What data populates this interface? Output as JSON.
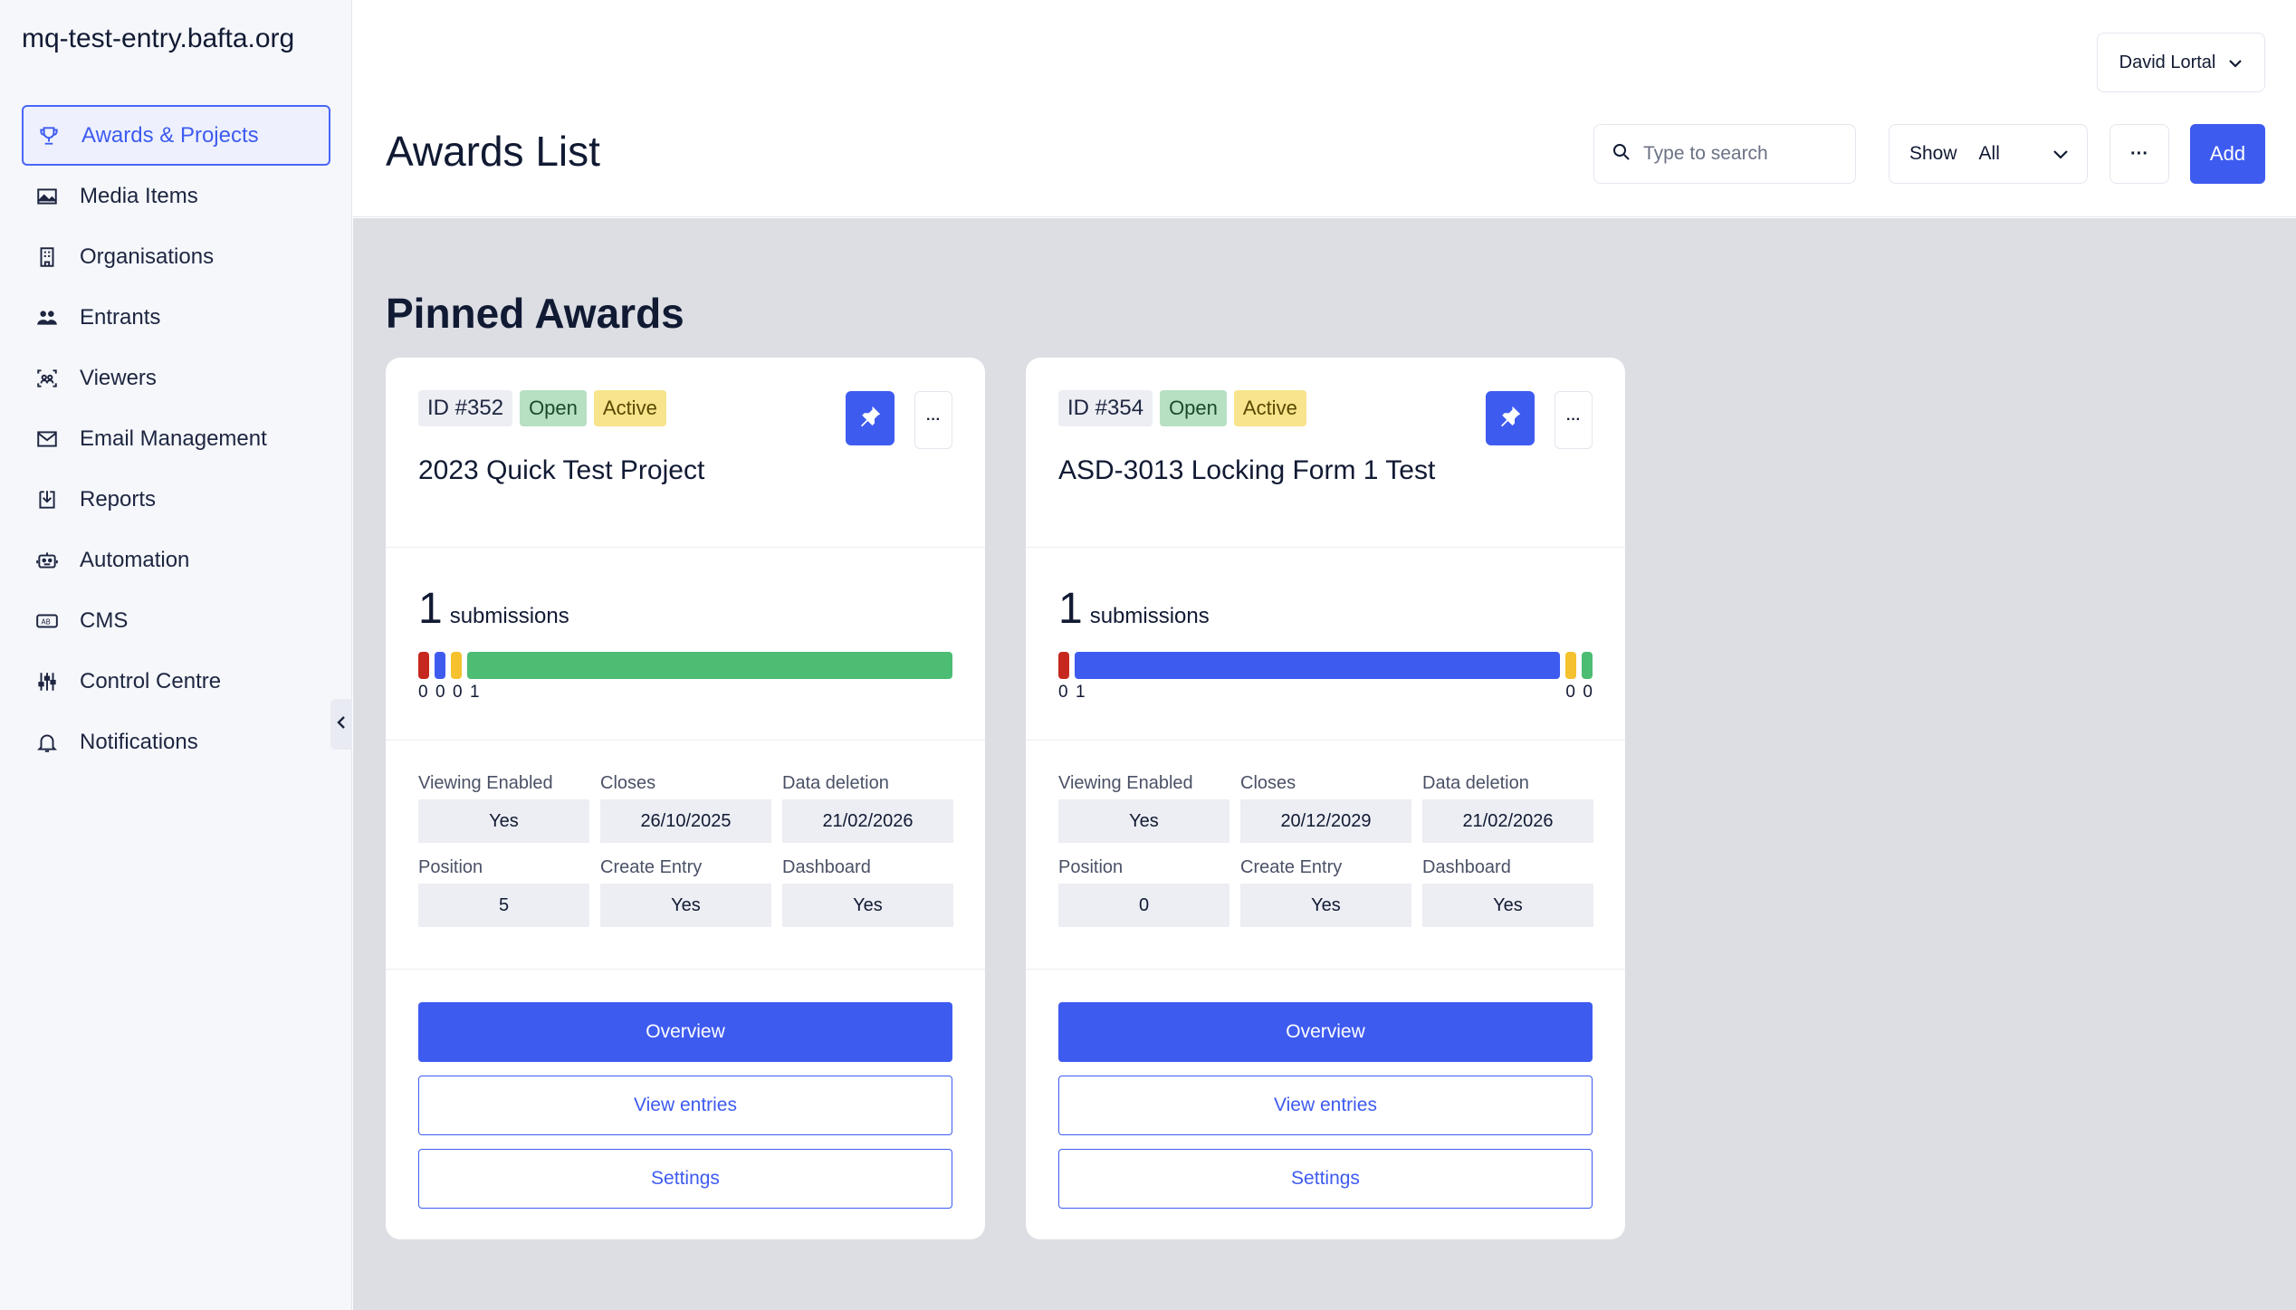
{
  "site": {
    "title": "mq-test-entry.bafta.org"
  },
  "sidebar": {
    "items": [
      {
        "label": "Awards & Projects",
        "icon": "trophy-icon",
        "active": true
      },
      {
        "label": "Media Items",
        "icon": "image-icon"
      },
      {
        "label": "Organisations",
        "icon": "building-icon"
      },
      {
        "label": "Entrants",
        "icon": "users-icon"
      },
      {
        "label": "Viewers",
        "icon": "viewers-icon"
      },
      {
        "label": "Email Management",
        "icon": "mail-icon"
      },
      {
        "label": "Reports",
        "icon": "download-icon"
      },
      {
        "label": "Automation",
        "icon": "robot-icon"
      },
      {
        "label": "CMS",
        "icon": "cms-icon"
      },
      {
        "label": "Control Centre",
        "icon": "sliders-icon"
      },
      {
        "label": "Notifications",
        "icon": "bell-icon"
      }
    ]
  },
  "header": {
    "user": "David Lortal",
    "title": "Awards List",
    "search_placeholder": "Type to search",
    "show_label": "Show",
    "show_value": "All",
    "more_label": "···",
    "add_label": "Add"
  },
  "main": {
    "section_title": "Pinned Awards",
    "cards": [
      {
        "id": "ID #352",
        "status_open": "Open",
        "status_active": "Active",
        "title": "2023 Quick Test Project",
        "submissions_count": "1",
        "submissions_label": "submissions",
        "bar_labels": [
          "0",
          "0",
          "0",
          "1"
        ],
        "fields": {
          "viewing_enabled_label": "Viewing Enabled",
          "viewing_enabled": "Yes",
          "closes_label": "Closes",
          "closes": "26/10/2025",
          "data_deletion_label": "Data deletion",
          "data_deletion": "21/02/2026",
          "position_label": "Position",
          "position": "5",
          "create_entry_label": "Create Entry",
          "create_entry": "Yes",
          "dashboard_label": "Dashboard",
          "dashboard": "Yes"
        },
        "overview_label": "Overview",
        "view_entries_label": "View entries",
        "settings_label": "Settings"
      },
      {
        "id": "ID #354",
        "status_open": "Open",
        "status_active": "Active",
        "title": "ASD-3013 Locking Form 1 Test",
        "submissions_count": "1",
        "submissions_label": "submissions",
        "bar_labels": [
          "0",
          "1",
          "0",
          "0"
        ],
        "fields": {
          "viewing_enabled_label": "Viewing Enabled",
          "viewing_enabled": "Yes",
          "closes_label": "Closes",
          "closes": "20/12/2029",
          "data_deletion_label": "Data deletion",
          "data_deletion": "21/02/2026",
          "position_label": "Position",
          "position": "0",
          "create_entry_label": "Create Entry",
          "create_entry": "Yes",
          "dashboard_label": "Dashboard",
          "dashboard": "Yes"
        },
        "overview_label": "Overview",
        "view_entries_label": "View entries",
        "settings_label": "Settings"
      }
    ]
  },
  "colors": {
    "accent": "#3e5bf0",
    "bar_red": "#c6281f",
    "bar_blue": "#3e5bf0",
    "bar_yellow": "#f5c12e",
    "bar_green": "#4dbd74"
  }
}
